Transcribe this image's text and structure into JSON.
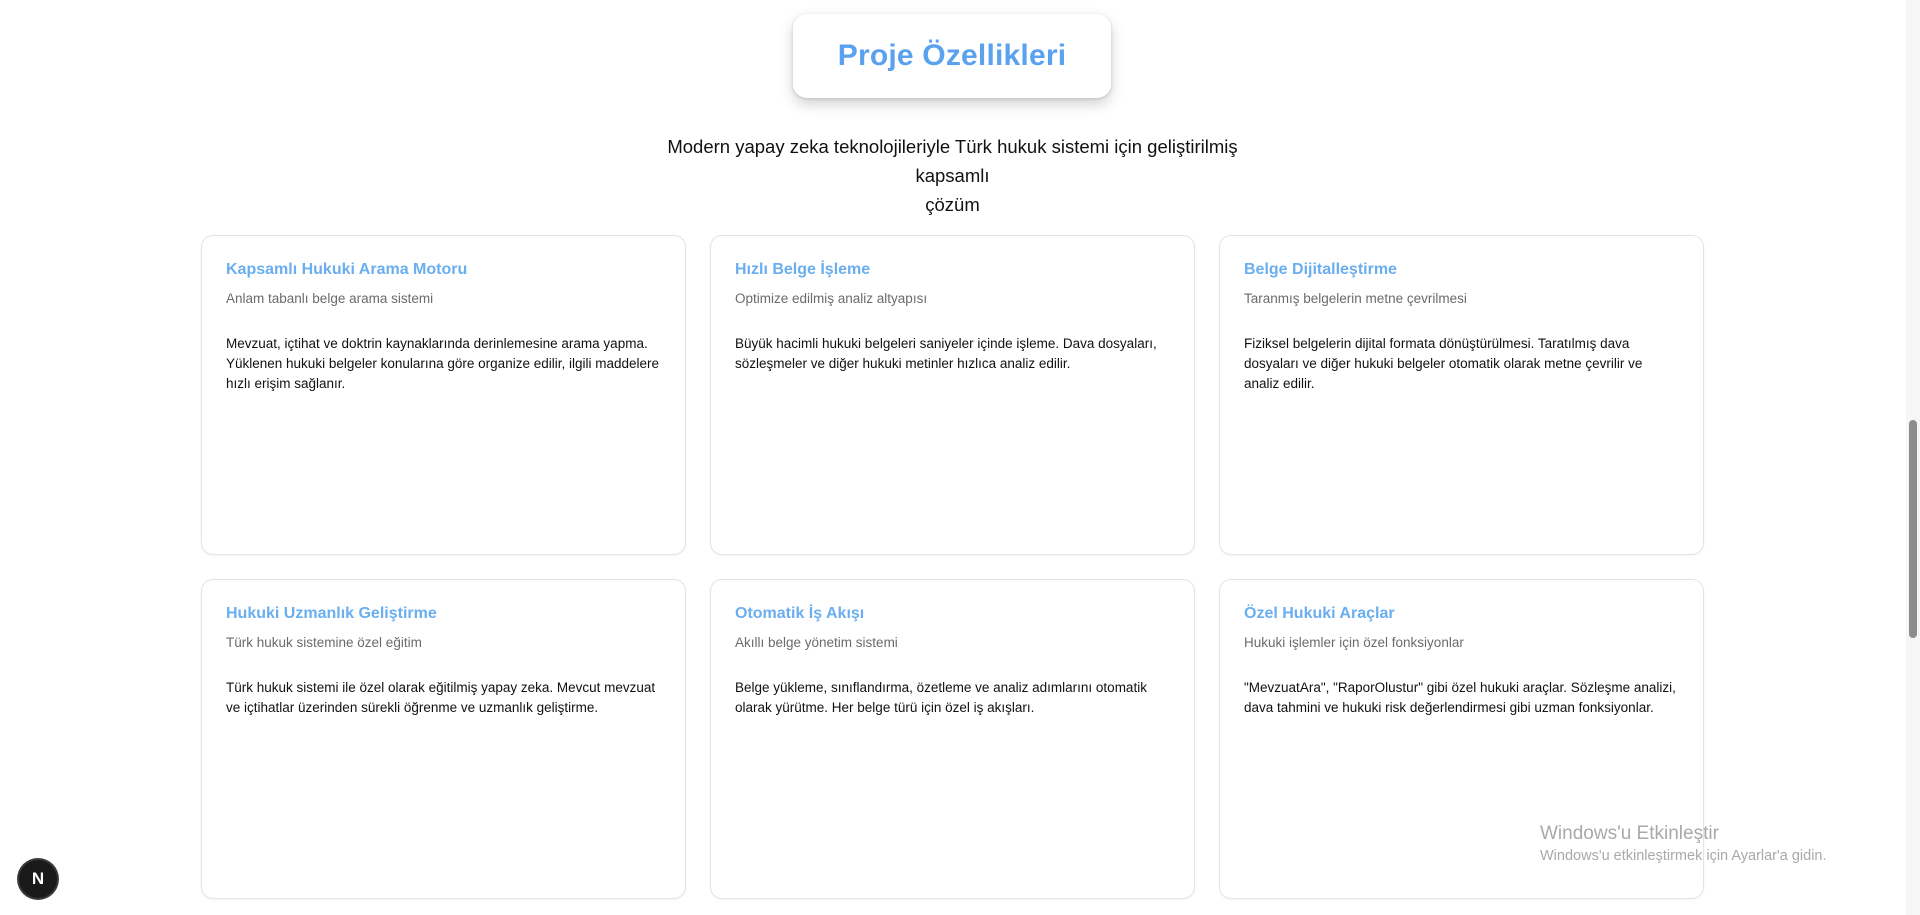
{
  "header": {
    "title": "Proje Özellikleri",
    "subtitle_line1": "Modern yapay zeka teknolojileriyle Türk hukuk sistemi için geliştirilmiş kapsamlı",
    "subtitle_line2": "çözüm"
  },
  "features": [
    {
      "title": "Kapsamlı Hukuki Arama Motoru",
      "subtitle": "Anlam tabanlı belge arama sistemi",
      "body": "Mevzuat, içtihat ve doktrin kaynaklarında derinlemesine arama yapma. Yüklenen hukuki belgeler konularına göre organize edilir, ilgili maddelere hızlı erişim sağlanır."
    },
    {
      "title": "Hızlı Belge İşleme",
      "subtitle": "Optimize edilmiş analiz altyapısı",
      "body": "Büyük hacimli hukuki belgeleri saniyeler içinde işleme. Dava dosyaları, sözleşmeler ve diğer hukuki metinler hızlıca analiz edilir."
    },
    {
      "title": "Belge Dijitalleştirme",
      "subtitle": "Taranmış belgelerin metne çevrilmesi",
      "body": "Fiziksel belgelerin dijital formata dönüştürülmesi. Taratılmış dava dosyaları ve diğer hukuki belgeler otomatik olarak metne çevrilir ve analiz edilir."
    },
    {
      "title": "Hukuki Uzmanlık Geliştirme",
      "subtitle": "Türk hukuk sistemine özel eğitim",
      "body": "Türk hukuk sistemi ile özel olarak eğitilmiş yapay zeka. Mevcut mevzuat ve içtihatlar üzerinden sürekli öğrenme ve uzmanlık geliştirme."
    },
    {
      "title": "Otomatik İş Akışı",
      "subtitle": "Akıllı belge yönetim sistemi",
      "body": "Belge yükleme, sınıflandırma, özetleme ve analiz adımlarını otomatik olarak yürütme. Her belge türü için özel iş akışları."
    },
    {
      "title": "Özel Hukuki Araçlar",
      "subtitle": "Hukuki işlemler için özel fonksiyonlar",
      "body": "\"MevzuatAra\", \"RaporOlustur\" gibi özel hukuki araçlar. Sözleşme analizi, dava tahmini ve hukuki risk değerlendirmesi gibi uzman fonksiyonlar."
    }
  ],
  "next_badge": {
    "letter": "N"
  },
  "watermark": {
    "line1": "Windows'u Etkinleştir",
    "line2": "Windows'u etkinleştirmek için Ayarlar'a gidin."
  },
  "colors": {
    "accent_title": "#5aa2f0",
    "card_title": "#6aaef0"
  }
}
